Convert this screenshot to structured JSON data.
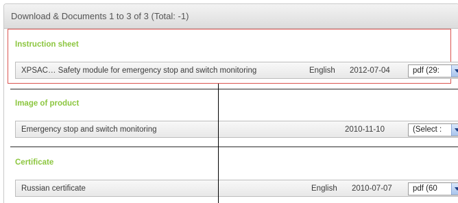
{
  "header": {
    "title": "Download & Documents 1 to 3 of 3 (Total: -1)"
  },
  "sections": [
    {
      "title": "Instruction sheet",
      "row": {
        "name": "XPSAC… Safety module for emergency stop and switch monitoring",
        "language": "English",
        "date": "2012-07-04",
        "select_value": "pdf (29:"
      }
    },
    {
      "title": "Image of product",
      "row": {
        "name": "Emergency stop and switch monitoring",
        "language": "",
        "date": "2010-11-10",
        "select_value": "(Select :"
      }
    },
    {
      "title": "Certificate",
      "row": {
        "name": "Russian certificate",
        "language": "English",
        "date": "2010-07-07",
        "select_value": "pdf (60"
      }
    }
  ],
  "colors": {
    "section_title": "#8cc63f",
    "highlight": "#d9534f",
    "select_arrow": "#a7c3ec"
  },
  "icons": [
    "chevron-down-icon"
  ]
}
